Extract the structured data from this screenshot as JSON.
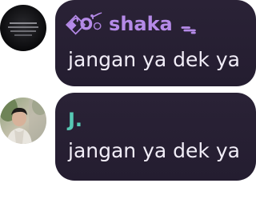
{
  "messages": [
    {
      "avatar_icon": "dark-profile-photo-icon",
      "sender_prefix": "ꗃ⃟𝐎ꪳ",
      "sender": "shaka",
      "sender_suffix": "ᯓ",
      "sender_color": "#b58ae8",
      "text": "jangan ya dek ya"
    },
    {
      "avatar_icon": "person-photo-icon",
      "sender": "J.",
      "sender_color": "#56c9b4",
      "text": "jangan ya dek ya"
    }
  ],
  "colors": {
    "bubble_bg": "#2a2236",
    "message_text": "#f1edf7"
  }
}
